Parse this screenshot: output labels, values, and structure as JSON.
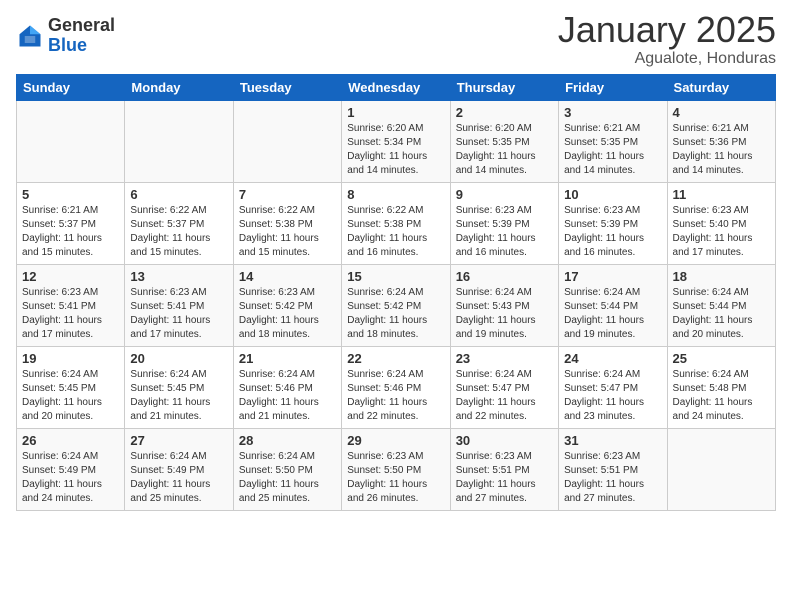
{
  "header": {
    "logo_general": "General",
    "logo_blue": "Blue",
    "month_title": "January 2025",
    "location": "Agualote, Honduras"
  },
  "weekdays": [
    "Sunday",
    "Monday",
    "Tuesday",
    "Wednesday",
    "Thursday",
    "Friday",
    "Saturday"
  ],
  "weeks": [
    [
      {
        "day": "",
        "content": ""
      },
      {
        "day": "",
        "content": ""
      },
      {
        "day": "",
        "content": ""
      },
      {
        "day": "1",
        "content": "Sunrise: 6:20 AM\nSunset: 5:34 PM\nDaylight: 11 hours and 14 minutes."
      },
      {
        "day": "2",
        "content": "Sunrise: 6:20 AM\nSunset: 5:35 PM\nDaylight: 11 hours and 14 minutes."
      },
      {
        "day": "3",
        "content": "Sunrise: 6:21 AM\nSunset: 5:35 PM\nDaylight: 11 hours and 14 minutes."
      },
      {
        "day": "4",
        "content": "Sunrise: 6:21 AM\nSunset: 5:36 PM\nDaylight: 11 hours and 14 minutes."
      }
    ],
    [
      {
        "day": "5",
        "content": "Sunrise: 6:21 AM\nSunset: 5:37 PM\nDaylight: 11 hours and 15 minutes."
      },
      {
        "day": "6",
        "content": "Sunrise: 6:22 AM\nSunset: 5:37 PM\nDaylight: 11 hours and 15 minutes."
      },
      {
        "day": "7",
        "content": "Sunrise: 6:22 AM\nSunset: 5:38 PM\nDaylight: 11 hours and 15 minutes."
      },
      {
        "day": "8",
        "content": "Sunrise: 6:22 AM\nSunset: 5:38 PM\nDaylight: 11 hours and 16 minutes."
      },
      {
        "day": "9",
        "content": "Sunrise: 6:23 AM\nSunset: 5:39 PM\nDaylight: 11 hours and 16 minutes."
      },
      {
        "day": "10",
        "content": "Sunrise: 6:23 AM\nSunset: 5:39 PM\nDaylight: 11 hours and 16 minutes."
      },
      {
        "day": "11",
        "content": "Sunrise: 6:23 AM\nSunset: 5:40 PM\nDaylight: 11 hours and 17 minutes."
      }
    ],
    [
      {
        "day": "12",
        "content": "Sunrise: 6:23 AM\nSunset: 5:41 PM\nDaylight: 11 hours and 17 minutes."
      },
      {
        "day": "13",
        "content": "Sunrise: 6:23 AM\nSunset: 5:41 PM\nDaylight: 11 hours and 17 minutes."
      },
      {
        "day": "14",
        "content": "Sunrise: 6:23 AM\nSunset: 5:42 PM\nDaylight: 11 hours and 18 minutes."
      },
      {
        "day": "15",
        "content": "Sunrise: 6:24 AM\nSunset: 5:42 PM\nDaylight: 11 hours and 18 minutes."
      },
      {
        "day": "16",
        "content": "Sunrise: 6:24 AM\nSunset: 5:43 PM\nDaylight: 11 hours and 19 minutes."
      },
      {
        "day": "17",
        "content": "Sunrise: 6:24 AM\nSunset: 5:44 PM\nDaylight: 11 hours and 19 minutes."
      },
      {
        "day": "18",
        "content": "Sunrise: 6:24 AM\nSunset: 5:44 PM\nDaylight: 11 hours and 20 minutes."
      }
    ],
    [
      {
        "day": "19",
        "content": "Sunrise: 6:24 AM\nSunset: 5:45 PM\nDaylight: 11 hours and 20 minutes."
      },
      {
        "day": "20",
        "content": "Sunrise: 6:24 AM\nSunset: 5:45 PM\nDaylight: 11 hours and 21 minutes."
      },
      {
        "day": "21",
        "content": "Sunrise: 6:24 AM\nSunset: 5:46 PM\nDaylight: 11 hours and 21 minutes."
      },
      {
        "day": "22",
        "content": "Sunrise: 6:24 AM\nSunset: 5:46 PM\nDaylight: 11 hours and 22 minutes."
      },
      {
        "day": "23",
        "content": "Sunrise: 6:24 AM\nSunset: 5:47 PM\nDaylight: 11 hours and 22 minutes."
      },
      {
        "day": "24",
        "content": "Sunrise: 6:24 AM\nSunset: 5:47 PM\nDaylight: 11 hours and 23 minutes."
      },
      {
        "day": "25",
        "content": "Sunrise: 6:24 AM\nSunset: 5:48 PM\nDaylight: 11 hours and 24 minutes."
      }
    ],
    [
      {
        "day": "26",
        "content": "Sunrise: 6:24 AM\nSunset: 5:49 PM\nDaylight: 11 hours and 24 minutes."
      },
      {
        "day": "27",
        "content": "Sunrise: 6:24 AM\nSunset: 5:49 PM\nDaylight: 11 hours and 25 minutes."
      },
      {
        "day": "28",
        "content": "Sunrise: 6:24 AM\nSunset: 5:50 PM\nDaylight: 11 hours and 25 minutes."
      },
      {
        "day": "29",
        "content": "Sunrise: 6:23 AM\nSunset: 5:50 PM\nDaylight: 11 hours and 26 minutes."
      },
      {
        "day": "30",
        "content": "Sunrise: 6:23 AM\nSunset: 5:51 PM\nDaylight: 11 hours and 27 minutes."
      },
      {
        "day": "31",
        "content": "Sunrise: 6:23 AM\nSunset: 5:51 PM\nDaylight: 11 hours and 27 minutes."
      },
      {
        "day": "",
        "content": ""
      }
    ]
  ]
}
